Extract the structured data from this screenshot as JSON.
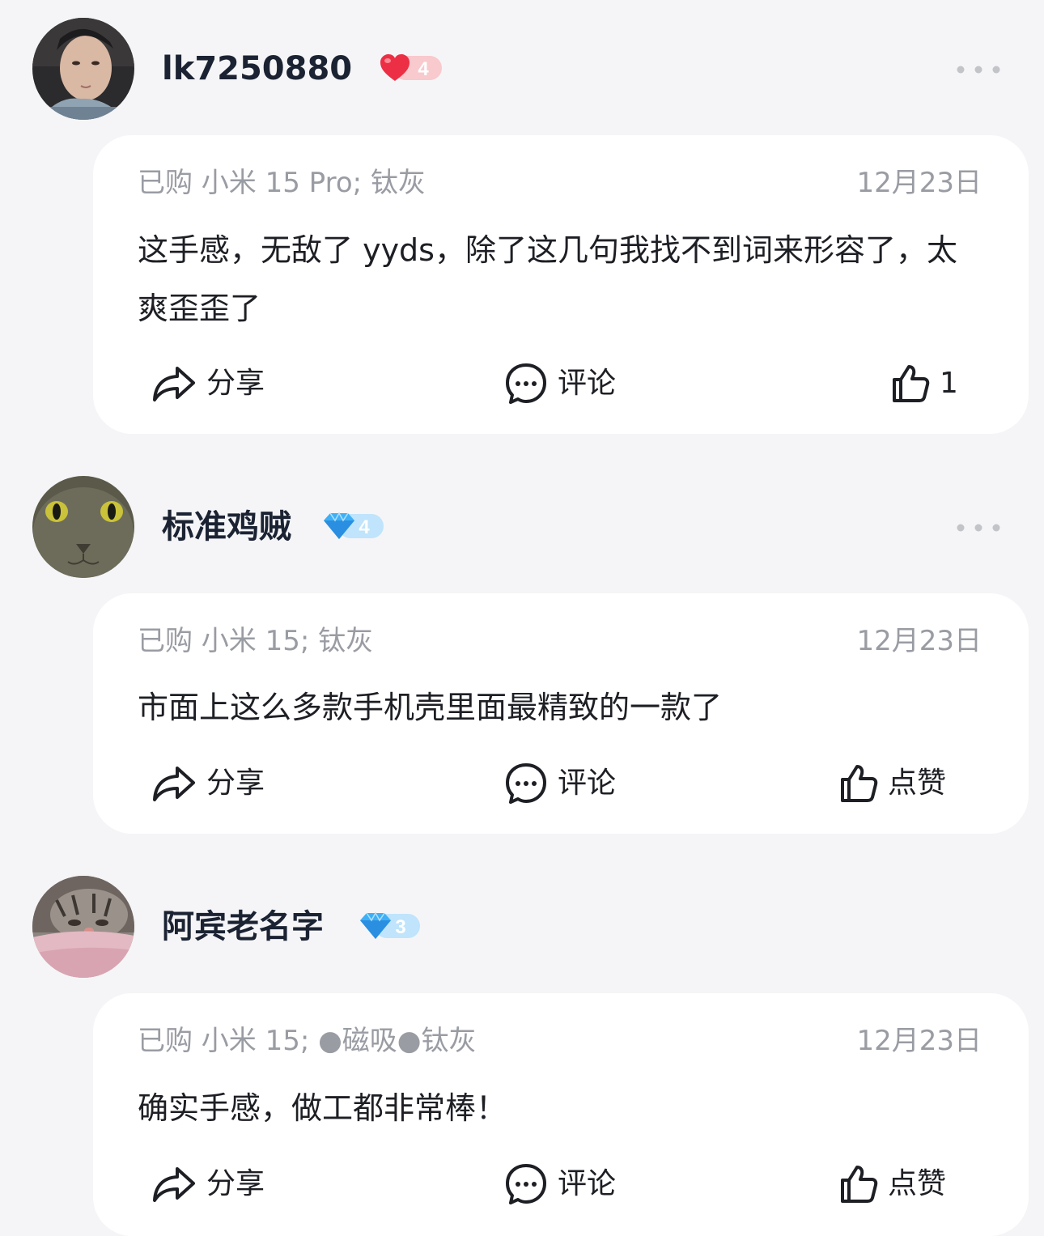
{
  "reviews": [
    {
      "username": "lk7250880",
      "badge_level": "4",
      "badge_type": "heart",
      "meta": "已购 小米 15 Pro; 钛灰",
      "date": "12月23日",
      "content": "这手感，无敌了 yyds，除了这几句我找不到词来形容了，太爽歪歪了",
      "share_label": "分享",
      "comment_label": "评论",
      "like_label": "1"
    },
    {
      "username": "标准鸡贼",
      "badge_level": "4",
      "badge_type": "diamond",
      "meta": "已购 小米 15; 钛灰",
      "date": "12月23日",
      "content": "市面上这么多款手机壳里面最精致的一款了",
      "share_label": "分享",
      "comment_label": "评论",
      "like_label": "点赞"
    },
    {
      "username": "阿宾老名字",
      "badge_level": "3",
      "badge_type": "diamond",
      "meta": "已购 小米 15; ●磁吸●钛灰",
      "date": "12月23日",
      "content": "确实手感，做工都非常棒！",
      "share_label": "分享",
      "comment_label": "评论",
      "like_label": "点赞"
    }
  ],
  "icons": {
    "share": "share-icon",
    "comment": "comment-icon",
    "like": "thumbs-up-icon",
    "more": "more-icon"
  },
  "colors": {
    "background": "#f5f5f7",
    "card": "#ffffff",
    "text": "#1d1f24",
    "muted": "#9a9ca3",
    "heart_badge": "#ef3b4b",
    "diamond_badge": "#3fb0f5"
  }
}
